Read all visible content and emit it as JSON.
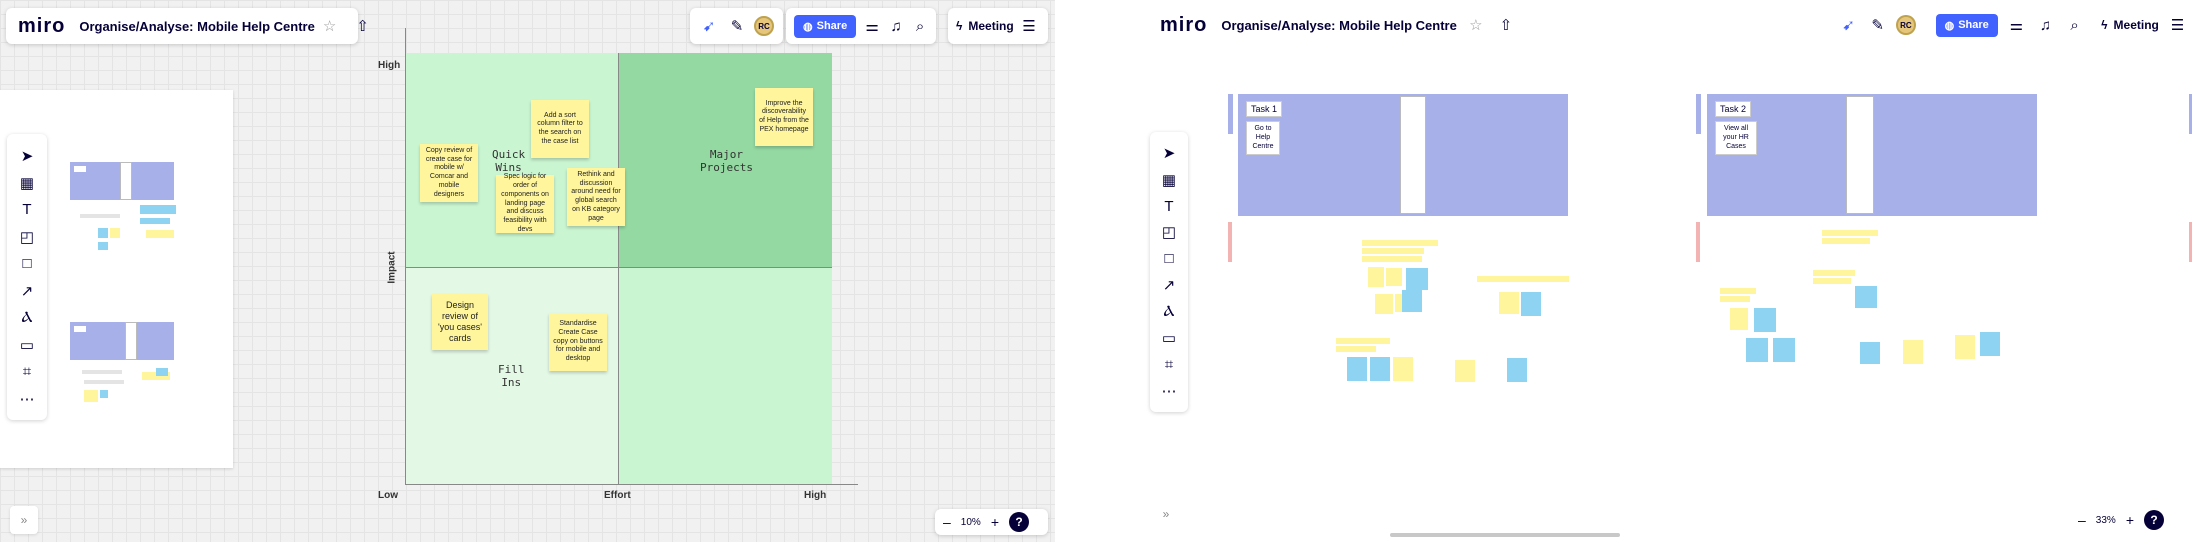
{
  "colors": {
    "accent": "#4262ff",
    "quad_bright": "#94d9a2",
    "quad_light": "#c9f5d0",
    "quad_pale": "#e4f8e6",
    "sticky": "#fff59d",
    "task_band": "#a8b0ea"
  },
  "left": {
    "header": {
      "logo": "miro",
      "board_title": "Organise/Analyse: Mobile Help Centre",
      "star_icon": "star-icon",
      "export_icon": "upload-icon"
    },
    "collab": {
      "share_label": "Share",
      "avatar_initials": "RC",
      "meeting_label": "Meeting"
    },
    "tools": [
      "select-icon",
      "table-icon",
      "text-icon",
      "sticky-note-icon",
      "shape-icon",
      "arrow-icon",
      "pen-icon",
      "comment-icon",
      "frame-icon",
      "more-icon"
    ],
    "matrix": {
      "y_high": "High",
      "y_axis": "Impact",
      "x_low": "Low",
      "x_axis": "Effort",
      "x_high": "High",
      "quadrants": {
        "quick_wins": "Quick\nWins",
        "major_projects": "Major\nProjects",
        "fill_ins": "Fill\nIns"
      },
      "stickies": [
        "Copy review of create case for mobile w/ Comcar and mobile designers",
        "Add a sort column filter to the search on the case list",
        "Spec logic for order of components on landing page and discuss feasibility with devs",
        "Rethink and discussion around need for global search on KB category page",
        "Improve the discoverability of Help from the PEX homepage",
        "Design review of 'you cases' cards",
        "Standardise Create Case copy on buttons for mobile and desktop"
      ]
    },
    "zoom": {
      "level": "10%",
      "minus": "–",
      "plus": "+",
      "help": "?"
    },
    "expand": "»"
  },
  "right": {
    "header": {
      "logo": "miro",
      "board_title": "Organise/Analyse: Mobile Help Centre"
    },
    "collab": {
      "share_label": "Share",
      "avatar_initials": "RC",
      "meeting_label": "Meeting"
    },
    "tasks": [
      {
        "label": "Task 1",
        "note": "Go to Help Centre"
      },
      {
        "label": "Task 2",
        "note": "View all your HR Cases"
      }
    ],
    "zoom": {
      "level": "33%",
      "minus": "–",
      "plus": "+",
      "help": "?"
    },
    "expand": "»"
  }
}
